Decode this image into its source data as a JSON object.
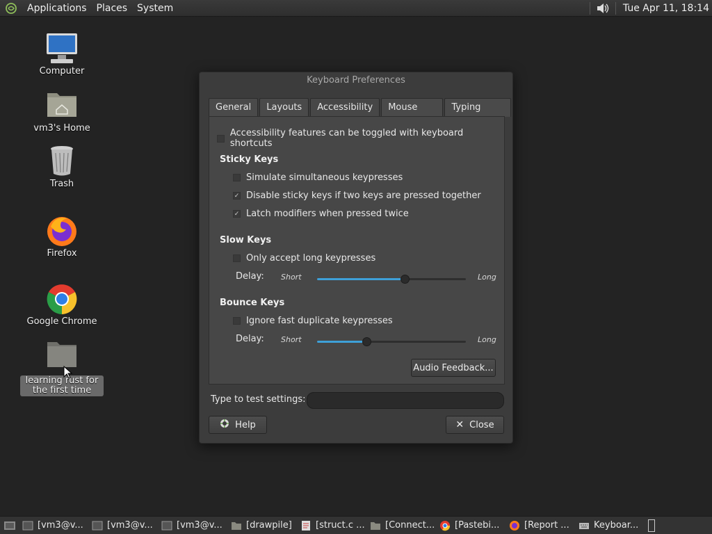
{
  "top_panel": {
    "menus": [
      "Applications",
      "Places",
      "System"
    ],
    "clock": "Tue Apr 11, 18:14"
  },
  "desktop": {
    "icons": [
      {
        "label": "Computer",
        "icon": "computer-icon"
      },
      {
        "label": "vm3's Home",
        "icon": "home-folder-icon"
      },
      {
        "label": "Trash",
        "icon": "trash-icon"
      },
      {
        "label": "Firefox",
        "icon": "firefox-icon"
      },
      {
        "label": "Google Chrome",
        "icon": "chrome-icon"
      },
      {
        "label": "learning rust for the first time",
        "icon": "folder-icon"
      }
    ]
  },
  "dialog": {
    "title": "Keyboard Preferences",
    "tabs": [
      "General",
      "Layouts",
      "Accessibility",
      "Mouse Keys",
      "Typing Break"
    ],
    "active_tab": "Accessibility",
    "toggle_shortcuts": {
      "label": "Accessibility features can be toggled with keyboard shortcuts",
      "checked": false
    },
    "sticky": {
      "title": "Sticky Keys",
      "options": [
        {
          "label": "Simulate simultaneous keypresses",
          "checked": false
        },
        {
          "label": "Disable sticky keys if two keys are pressed together",
          "checked": true
        },
        {
          "label": "Latch modifiers when pressed twice",
          "checked": true
        }
      ]
    },
    "slow": {
      "title": "Slow Keys",
      "option": {
        "label": "Only accept long keypresses",
        "checked": false
      },
      "delay_label": "Delay:",
      "short": "Short",
      "long": "Long",
      "delay_fraction": 0.59
    },
    "bounce": {
      "title": "Bounce Keys",
      "option": {
        "label": "Ignore fast duplicate keypresses",
        "checked": false
      },
      "delay_label": "Delay:",
      "short": "Short",
      "long": "Long",
      "delay_fraction": 0.33
    },
    "audio_feedback": "Audio Feedback...",
    "test_label": "Type to test settings:",
    "test_value": "",
    "help": "Help",
    "close": "Close"
  },
  "taskbar": {
    "items": [
      {
        "label": "[vm3@v...",
        "icon": "terminal-icon"
      },
      {
        "label": "[vm3@v...",
        "icon": "terminal-icon"
      },
      {
        "label": "[vm3@v...",
        "icon": "terminal-icon"
      },
      {
        "label": "[drawpile]",
        "icon": "folder-icon"
      },
      {
        "label": "[struct.c ...",
        "icon": "text-editor-icon"
      },
      {
        "label": "[Connect...",
        "icon": "folder-icon"
      },
      {
        "label": "[Pastebi...",
        "icon": "chrome-icon"
      },
      {
        "label": "[Report ...",
        "icon": "firefox-icon"
      },
      {
        "label": "Keyboar...",
        "icon": "keyboard-icon"
      }
    ]
  },
  "colors": {
    "accent": "#3ea0d8",
    "panel": "#333333",
    "desktop": "#232323"
  }
}
